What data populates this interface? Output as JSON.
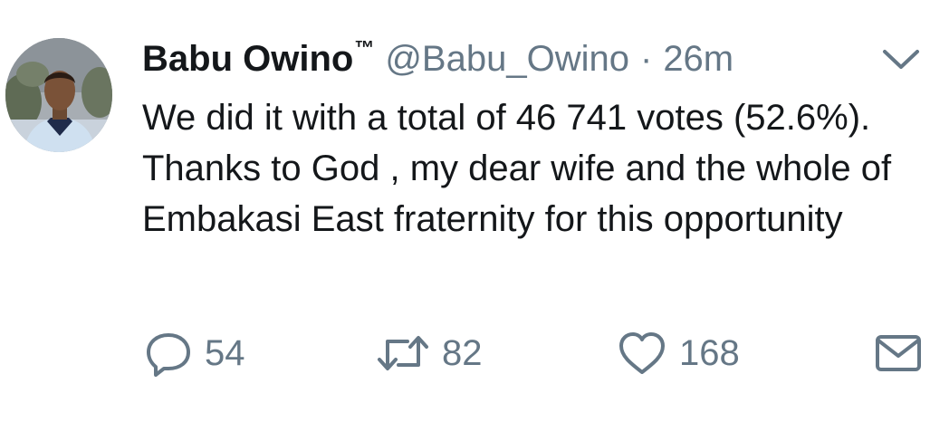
{
  "tweet": {
    "author_name": "Babu Owino",
    "author_tm": "™",
    "handle": "@Babu_Owino",
    "separator": "·",
    "time": "26m",
    "text": "We did it with a total of 46 741 votes (52.6%). Thanks to God , my dear wife and the whole of Embakasi East fraternity for this opportunity"
  },
  "actions": {
    "reply_count": "54",
    "retweet_count": "82",
    "like_count": "168"
  },
  "icons": {
    "caret": "chevron-down-icon",
    "reply": "reply-icon",
    "retweet": "retweet-icon",
    "like": "heart-icon",
    "dm": "envelope-icon"
  },
  "colors": {
    "text": "#14171a",
    "secondary": "#657786"
  }
}
